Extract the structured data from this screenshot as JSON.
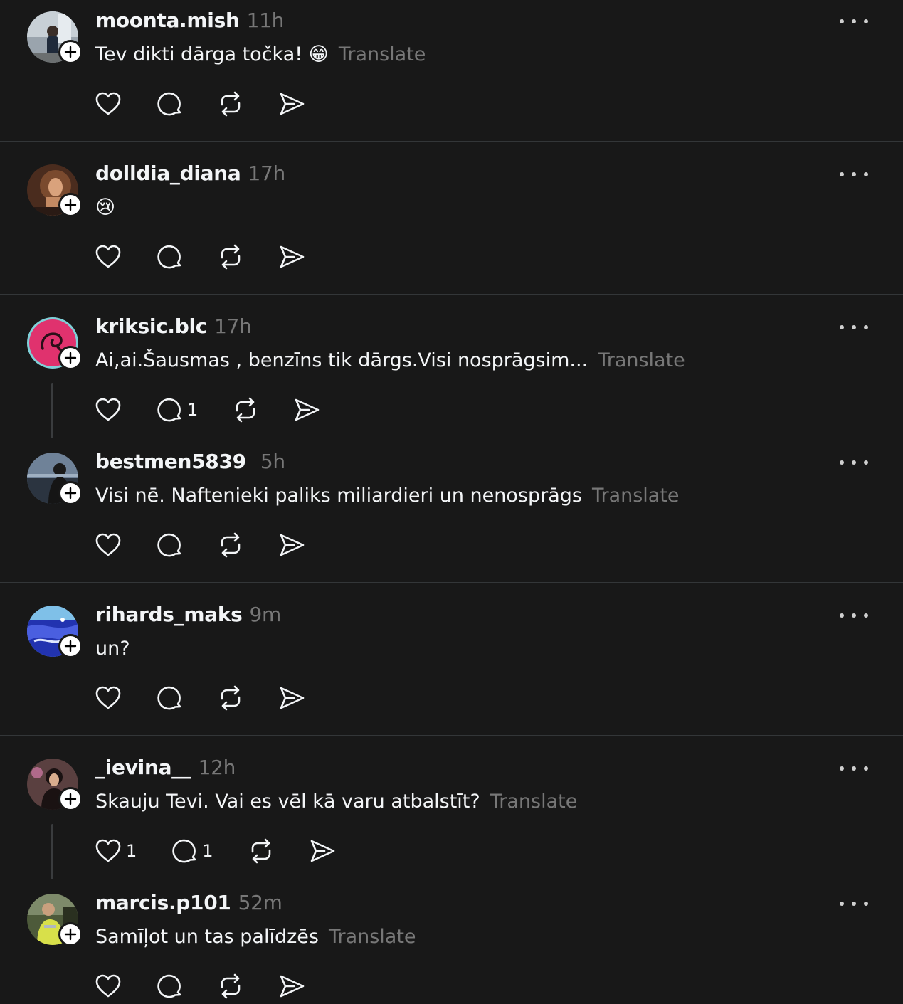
{
  "ui": {
    "translate_label": "Translate"
  },
  "posts": [
    {
      "username": "moonta.mish",
      "time": "11h",
      "text": "Tev dikti dārga točka! 😁",
      "show_translate": true,
      "likes": "",
      "replies": "",
      "avatar_colors": [
        "#6c7a8a",
        "#d7dde3"
      ]
    },
    {
      "username": "dolldia_diana",
      "time": "17h",
      "text": "😢",
      "show_translate": false,
      "likes": "",
      "replies": "",
      "avatar_colors": [
        "#5b3320",
        "#b8815a"
      ]
    },
    {
      "username": "kriksic.blc",
      "time": "17h",
      "text": "Ai,ai.Šausmas , benzīns tik dārgs.Visi nosprāgsim...",
      "show_translate": true,
      "likes": "",
      "replies": "1",
      "avatar_colors": [
        "#e0326e",
        "#7fd0d8"
      ]
    },
    {
      "username": "bestmen5839",
      "time": "5h",
      "text": "Visi nē. Naftenieki paliks miliardieri un nenosprāgs",
      "show_translate": true,
      "likes": "",
      "replies": "",
      "avatar_colors": [
        "#2b3440",
        "#8a9bb0"
      ]
    },
    {
      "username": "rihards_maks",
      "time": "9m",
      "text": "un?",
      "show_translate": false,
      "likes": "",
      "replies": "",
      "avatar_colors": [
        "#1d2fa8",
        "#7fc0e8"
      ]
    },
    {
      "username": "_ievina__",
      "time": "12h",
      "text": "Skauju Tevi. Vai es vēl kā varu atbalstīt?",
      "show_translate": true,
      "likes": "1",
      "replies": "1",
      "avatar_colors": [
        "#3a2a2a",
        "#c79a7a"
      ]
    },
    {
      "username": "marcis.p101",
      "time": "52m",
      "text": "Samīļot un tas palīdzēs",
      "show_translate": true,
      "likes": "",
      "replies": "",
      "avatar_colors": [
        "#3d4a2a",
        "#d8e04a"
      ]
    }
  ],
  "icons": {
    "like": "heart-icon",
    "reply": "comment-bubble-icon",
    "repost": "repost-icon",
    "share": "send-icon",
    "more": "more-dots-icon",
    "follow": "plus-icon"
  }
}
